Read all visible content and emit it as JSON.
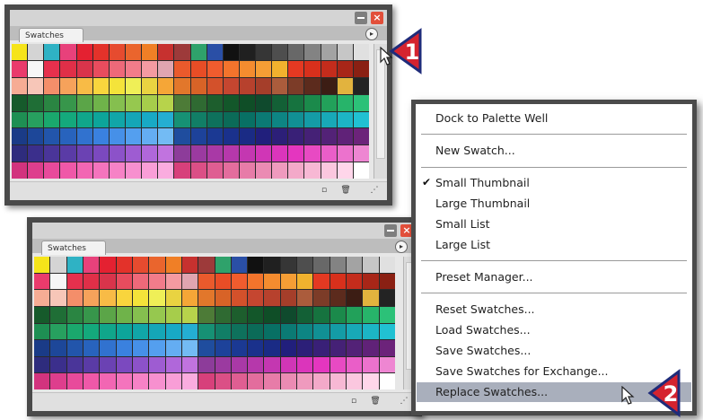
{
  "panel_title": "Swatches",
  "callouts": [
    "1",
    "2"
  ],
  "menu": {
    "items": [
      "Dock to Palette Well",
      "New Swatch...",
      "Small Thumbnail",
      "Large Thumbnail",
      "Small List",
      "Large List",
      "Preset Manager...",
      "Reset Swatches...",
      "Load Swatches...",
      "Save Swatches...",
      "Save Swatches for Exchange...",
      "Replace Swatches..."
    ],
    "checked": "Small Thumbnail",
    "highlighted": "Replace Swatches...",
    "check_mark": "✔"
  },
  "colors": {
    "row0": [
      "#f6e41a",
      "#d4d4d4",
      "#2fb2c4",
      "#e8417b",
      "#e42131",
      "#e3322a",
      "#e64b2f",
      "#ea652d",
      "#f07f26",
      "#c7312f",
      "#9d3a3a",
      "#2fa26b",
      "#2a4fa6",
      "#111111",
      "#202020",
      "#363636",
      "#4e4e4e",
      "#686868",
      "#838383",
      "#a3a3a3",
      "#c6c6c6",
      "#e0e0e0",
      "#f4f4f4"
    ],
    "row1": [
      "#e93b6c",
      "#f6f6f6",
      "#e6304d",
      "#e02f48",
      "#d9344b",
      "#e84c5e",
      "#ee6979",
      "#f27c8a",
      "#f49aa1",
      "#e0a5b0",
      "#ea5a2c",
      "#e84d26",
      "#f05c2e",
      "#f3742c",
      "#f48c2f",
      "#f59e35",
      "#f1b22e",
      "#e43922",
      "#d8301c",
      "#c42c1c",
      "#a82618",
      "#8a2013"
    ],
    "row2": [
      "#f6ac94",
      "#f7c6b8",
      "#f48e6a",
      "#f6a25b",
      "#f8bb46",
      "#f9d53d",
      "#f4e33a",
      "#efef57",
      "#e9d341",
      "#f5a637",
      "#e2772b",
      "#d86327",
      "#d3512b",
      "#c54630",
      "#b7412d",
      "#a53e2a",
      "#ab5c3c",
      "#7c3c28",
      "#5c2b1d",
      "#3c1d14",
      "#e2b33e",
      "#232323"
    ],
    "row3": [
      "#165a2b",
      "#1f6e36",
      "#2a8542",
      "#37964b",
      "#5ba548",
      "#6fb34a",
      "#85bf4f",
      "#96c84f",
      "#a6cd4b",
      "#b7d34b",
      "#4d7b37",
      "#2f6a32",
      "#1d5e2d",
      "#13572a",
      "#0f4e27",
      "#0f4a2d",
      "#136036",
      "#16733f",
      "#1b8a4b",
      "#22a15a",
      "#27b46a",
      "#2cc178"
    ],
    "row4": [
      "#1e8f53",
      "#27a05f",
      "#1aa86d",
      "#14a97c",
      "#10a68b",
      "#0da59a",
      "#11a6a8",
      "#15a6b7",
      "#18a9c5",
      "#24aed2",
      "#169174",
      "#117e66",
      "#0e715c",
      "#0b6b58",
      "#087064",
      "#0b7a74",
      "#0d8583",
      "#119094",
      "#149ca6",
      "#18a9b7",
      "#1cb5c5",
      "#21c1d2"
    ],
    "row5": [
      "#1a3b87",
      "#1d4799",
      "#2255ab",
      "#2863bd",
      "#3172cf",
      "#3a81df",
      "#4690e8",
      "#549fef",
      "#64adf2",
      "#73bbf4",
      "#1f4d9e",
      "#1d429a",
      "#1b3993",
      "#1a318c",
      "#1a2b85",
      "#211f7c",
      "#2c1f78",
      "#392077",
      "#452176",
      "#532277",
      "#602278",
      "#6c237a"
    ],
    "row6": [
      "#2e2c7d",
      "#3b2f8c",
      "#4a3599",
      "#5a3ba6",
      "#6b42b3",
      "#7b49bf",
      "#8c52c9",
      "#9e5cd2",
      "#b067da",
      "#c173df",
      "#8d3c9a",
      "#9b3aa0",
      "#a939a6",
      "#b638ab",
      "#c437b1",
      "#d036b6",
      "#db35bb",
      "#e436bf",
      "#e84ac3",
      "#ea5ec8",
      "#ec72cd",
      "#ee86d2"
    ],
    "row7": [
      "#d2337e",
      "#de3e8d",
      "#e84a9b",
      "#ef58a8",
      "#f266b3",
      "#f474bd",
      "#f682c6",
      "#f790cf",
      "#f99ed7",
      "#faacdf",
      "#d7407b",
      "#db4f86",
      "#df5e92",
      "#e36d9d",
      "#e77ca8",
      "#eb8bb3",
      "#ef9abe",
      "#f3a9c9",
      "#f7b8d4",
      "#fbc7df",
      "#ffd6ea",
      "#ffffff"
    ]
  }
}
